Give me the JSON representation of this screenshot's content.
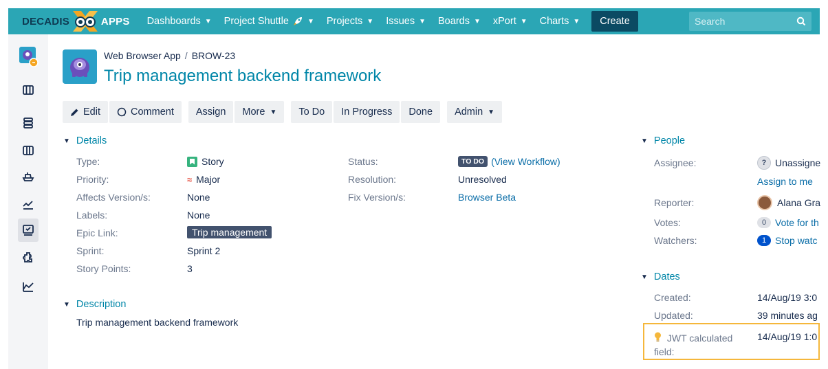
{
  "brand": {
    "name_left": "DECADIS",
    "name_right": "APPS"
  },
  "nav": {
    "items": [
      {
        "label": "Dashboards"
      },
      {
        "label": "Project Shuttle"
      },
      {
        "label": "Projects"
      },
      {
        "label": "Issues"
      },
      {
        "label": "Boards"
      },
      {
        "label": "xPort"
      },
      {
        "label": "Charts"
      }
    ],
    "create_label": "Create",
    "search_placeholder": "Search"
  },
  "breadcrumb": {
    "project": "Web Browser App",
    "separator": "/",
    "issue_key": "BROW-23"
  },
  "issue": {
    "title": "Trip management backend framework"
  },
  "toolbar": {
    "edit": "Edit",
    "comment": "Comment",
    "assign": "Assign",
    "more": "More",
    "todo": "To Do",
    "in_progress": "In Progress",
    "done": "Done",
    "admin": "Admin"
  },
  "details": {
    "heading": "Details",
    "type_label": "Type:",
    "type_value": "Story",
    "priority_label": "Priority:",
    "priority_value": "Major",
    "affects_label": "Affects Version/s:",
    "affects_value": "None",
    "labels_label": "Labels:",
    "labels_value": "None",
    "epic_label": "Epic Link:",
    "epic_value": "Trip management",
    "sprint_label": "Sprint:",
    "sprint_value": "Sprint 2",
    "points_label": "Story Points:",
    "points_value": "3",
    "status_label": "Status:",
    "status_badge": "TO DO",
    "status_link": "(View Workflow)",
    "resolution_label": "Resolution:",
    "resolution_value": "Unresolved",
    "fix_label": "Fix Version/s:",
    "fix_value": "Browser Beta"
  },
  "description": {
    "heading": "Description",
    "text": "Trip management backend framework"
  },
  "people": {
    "heading": "People",
    "assignee_label": "Assignee:",
    "assignee_value": "Unassigne",
    "assign_to_me": "Assign to me",
    "reporter_label": "Reporter:",
    "reporter_value": "Alana Gra",
    "votes_label": "Votes:",
    "votes_count": "0",
    "votes_link": "Vote for th",
    "watchers_label": "Watchers:",
    "watchers_count": "1",
    "watchers_link": "Stop watc"
  },
  "dates": {
    "heading": "Dates",
    "created_label": "Created:",
    "created_value": "14/Aug/19 3:0",
    "updated_label": "Updated:",
    "updated_value": "39 minutes ag",
    "jwt_label_line1": "JWT calculated",
    "jwt_label_line2": "field:",
    "jwt_value": "14/Aug/19 1:0"
  },
  "colors": {
    "nav_bg": "#2ba6b5",
    "link": "#0086a8",
    "highlight": "#f5b73b",
    "create_bg": "#0b4a63"
  }
}
